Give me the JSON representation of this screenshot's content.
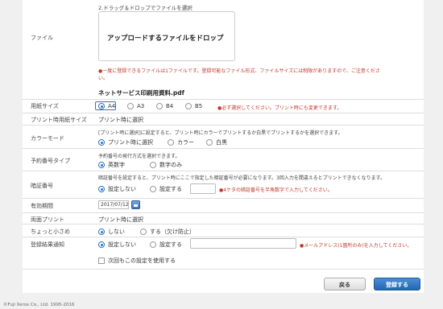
{
  "upload": {
    "step_label": "2.ドラッグ＆ドロップでファイルを選択",
    "file_label": "ファイル",
    "dropzone_text": "アップロードするファイルをドロップ",
    "note_line1": "●一度に登録できるファイルは1ファイルです。登録可能なファイル形式、ファイルサイズには制限がありますので、ご注意くださ",
    "note_line2": "い。",
    "filename": "ネットサービス印刷用資料.pdf"
  },
  "paper_size": {
    "label": "用紙サイズ",
    "options": [
      "A4",
      "A3",
      "B4",
      "B5"
    ],
    "selected": "A4",
    "note": "●必ず選択してください。プリント時にも変更できます。"
  },
  "print_paper": {
    "label": "プリント時用紙サイズ",
    "value": "プリント時に選択"
  },
  "color_mode": {
    "label": "カラーモード",
    "description": "[プリント時に選択]に設定すると、プリント時にカラーでプリントするか白黒でプリントするかを選択できます。",
    "options": [
      "プリント時に選択",
      "カラー",
      "白黒"
    ],
    "selected": "プリント時に選択"
  },
  "reservation_type": {
    "label": "予約番号タイプ",
    "description": "予約番号の発行方式を選択できます。",
    "options": [
      "英数字",
      "数字のみ"
    ],
    "selected": "英数字"
  },
  "pin": {
    "label": "暗証番号",
    "description": "暗証番号を設定すると、プリント時にここで指定した暗証番号が必要になります。3回入力を間違えるとプリントできなくなります。",
    "options": [
      "設定しない",
      "設定する"
    ],
    "selected": "設定しない",
    "note": "●4ケタの暗証番号を半角数字で入力してください。"
  },
  "expiry": {
    "label": "有効期間",
    "date": "2017/07/12"
  },
  "duplex": {
    "label": "両面プリント",
    "value": "プリント時に選択"
  },
  "shrink": {
    "label": "ちょっと小さめ",
    "options": [
      "しない",
      "する（欠け防止）"
    ],
    "selected": "しない"
  },
  "notify": {
    "label": "登録結果通知",
    "options": [
      "設定しない",
      "設定する"
    ],
    "selected": "設定しない",
    "note": "●メールアドレス(1箇所のみ)を入力してください。"
  },
  "remember": {
    "label": "次回もこの設定を使用する",
    "checked": false
  },
  "buttons": {
    "back": "戻る",
    "register": "登録する"
  },
  "footer": "©Fuji Xerox Co., Ltd. 1995-2016",
  "colors": {
    "accent": "#2a78c4",
    "note": "#c0392b",
    "register_button": "#2d6fbd"
  }
}
